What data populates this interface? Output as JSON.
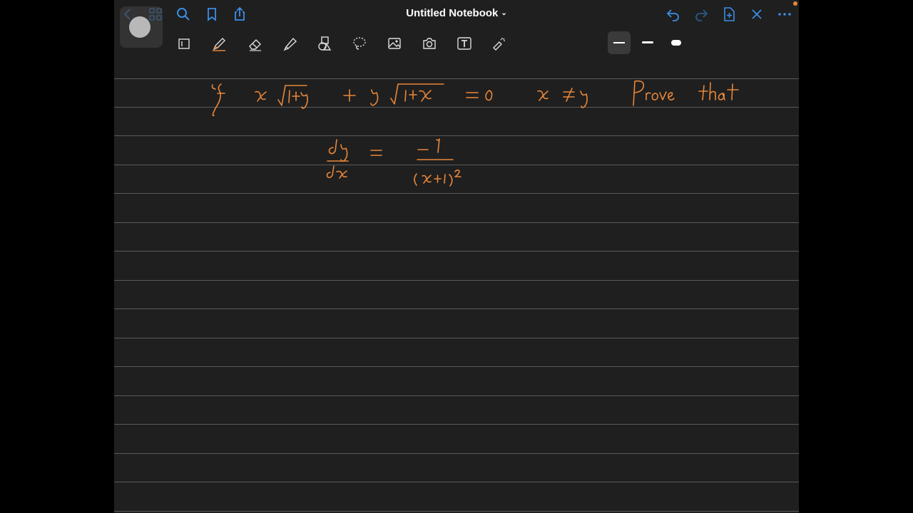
{
  "header": {
    "title": "Untitled Notebook",
    "title_chevron": "⌄"
  },
  "top_icons": {
    "left": [
      "back-icon",
      "grid-icon",
      "search-icon",
      "bookmark-icon",
      "share-icon"
    ],
    "right": [
      "undo-icon",
      "redo-icon",
      "add-page-icon",
      "close-icon",
      "more-icon"
    ]
  },
  "tools": [
    "pages-icon",
    "pen-icon",
    "eraser-icon",
    "highlighter-icon",
    "shapes-icon",
    "lasso-icon",
    "image-icon",
    "camera-icon",
    "text-icon",
    "laser-pointer-icon"
  ],
  "colors": {
    "accent": "#3a8ee6",
    "ink": "#e8873a",
    "swatch_orange": "#e8873a",
    "swatch_white": "#ffffff",
    "swatch_pink": "#f07a8a"
  },
  "stroke_sizes": [
    "thin",
    "medium",
    "thick"
  ],
  "stroke_selected": "thin",
  "handwriting": {
    "line1": "If x√(1+y) + y√(1+x) = 0, x ≠ y Prove that",
    "line2": "dy/dx = −1/(x+1)²"
  }
}
